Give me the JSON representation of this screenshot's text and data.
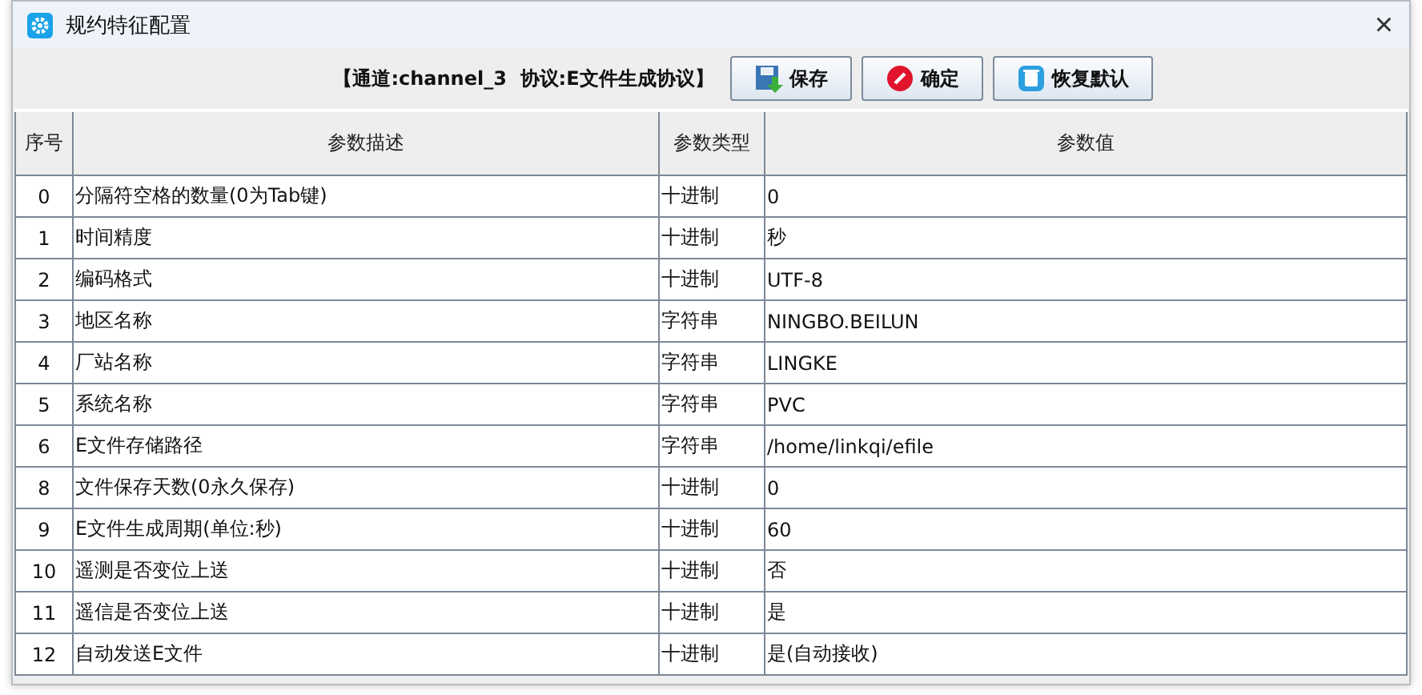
{
  "window": {
    "title": "规约特征配置",
    "close": "×"
  },
  "toolbar": {
    "caption": "【通道:channel_3  协议:E文件生成协议】",
    "buttons": [
      {
        "kind": "save",
        "label": "保存"
      },
      {
        "kind": "confirm",
        "label": "确定"
      },
      {
        "kind": "reset",
        "label": "恢复默认"
      }
    ]
  },
  "table": {
    "columns": [
      "序号",
      "参数描述",
      "参数类型",
      "参数值"
    ],
    "rows": [
      [
        "0",
        "分隔符空格的数量(0为Tab键)",
        "十进制",
        "0"
      ],
      [
        "1",
        "时间精度",
        "十进制",
        "秒"
      ],
      [
        "2",
        "编码格式",
        "十进制",
        "UTF-8"
      ],
      [
        "3",
        "地区名称",
        "字符串",
        "NINGBO.BEILUN"
      ],
      [
        "4",
        "厂站名称",
        "字符串",
        "LINGKE"
      ],
      [
        "5",
        "系统名称",
        "字符串",
        "PVC"
      ],
      [
        "6",
        "E文件存储路径",
        "字符串",
        "/home/linkqi/efile"
      ],
      [
        "8",
        "文件保存天数(0永久保存)",
        "十进制",
        "0"
      ],
      [
        "9",
        "E文件生成周期(单位:秒)",
        "十进制",
        "60"
      ],
      [
        "10",
        "遥测是否变位上送",
        "十进制",
        "否"
      ],
      [
        "11",
        "遥信是否变位上送",
        "十进制",
        "是"
      ],
      [
        "12",
        "自动发送E文件",
        "十进制",
        "是(自动接收)"
      ]
    ]
  }
}
